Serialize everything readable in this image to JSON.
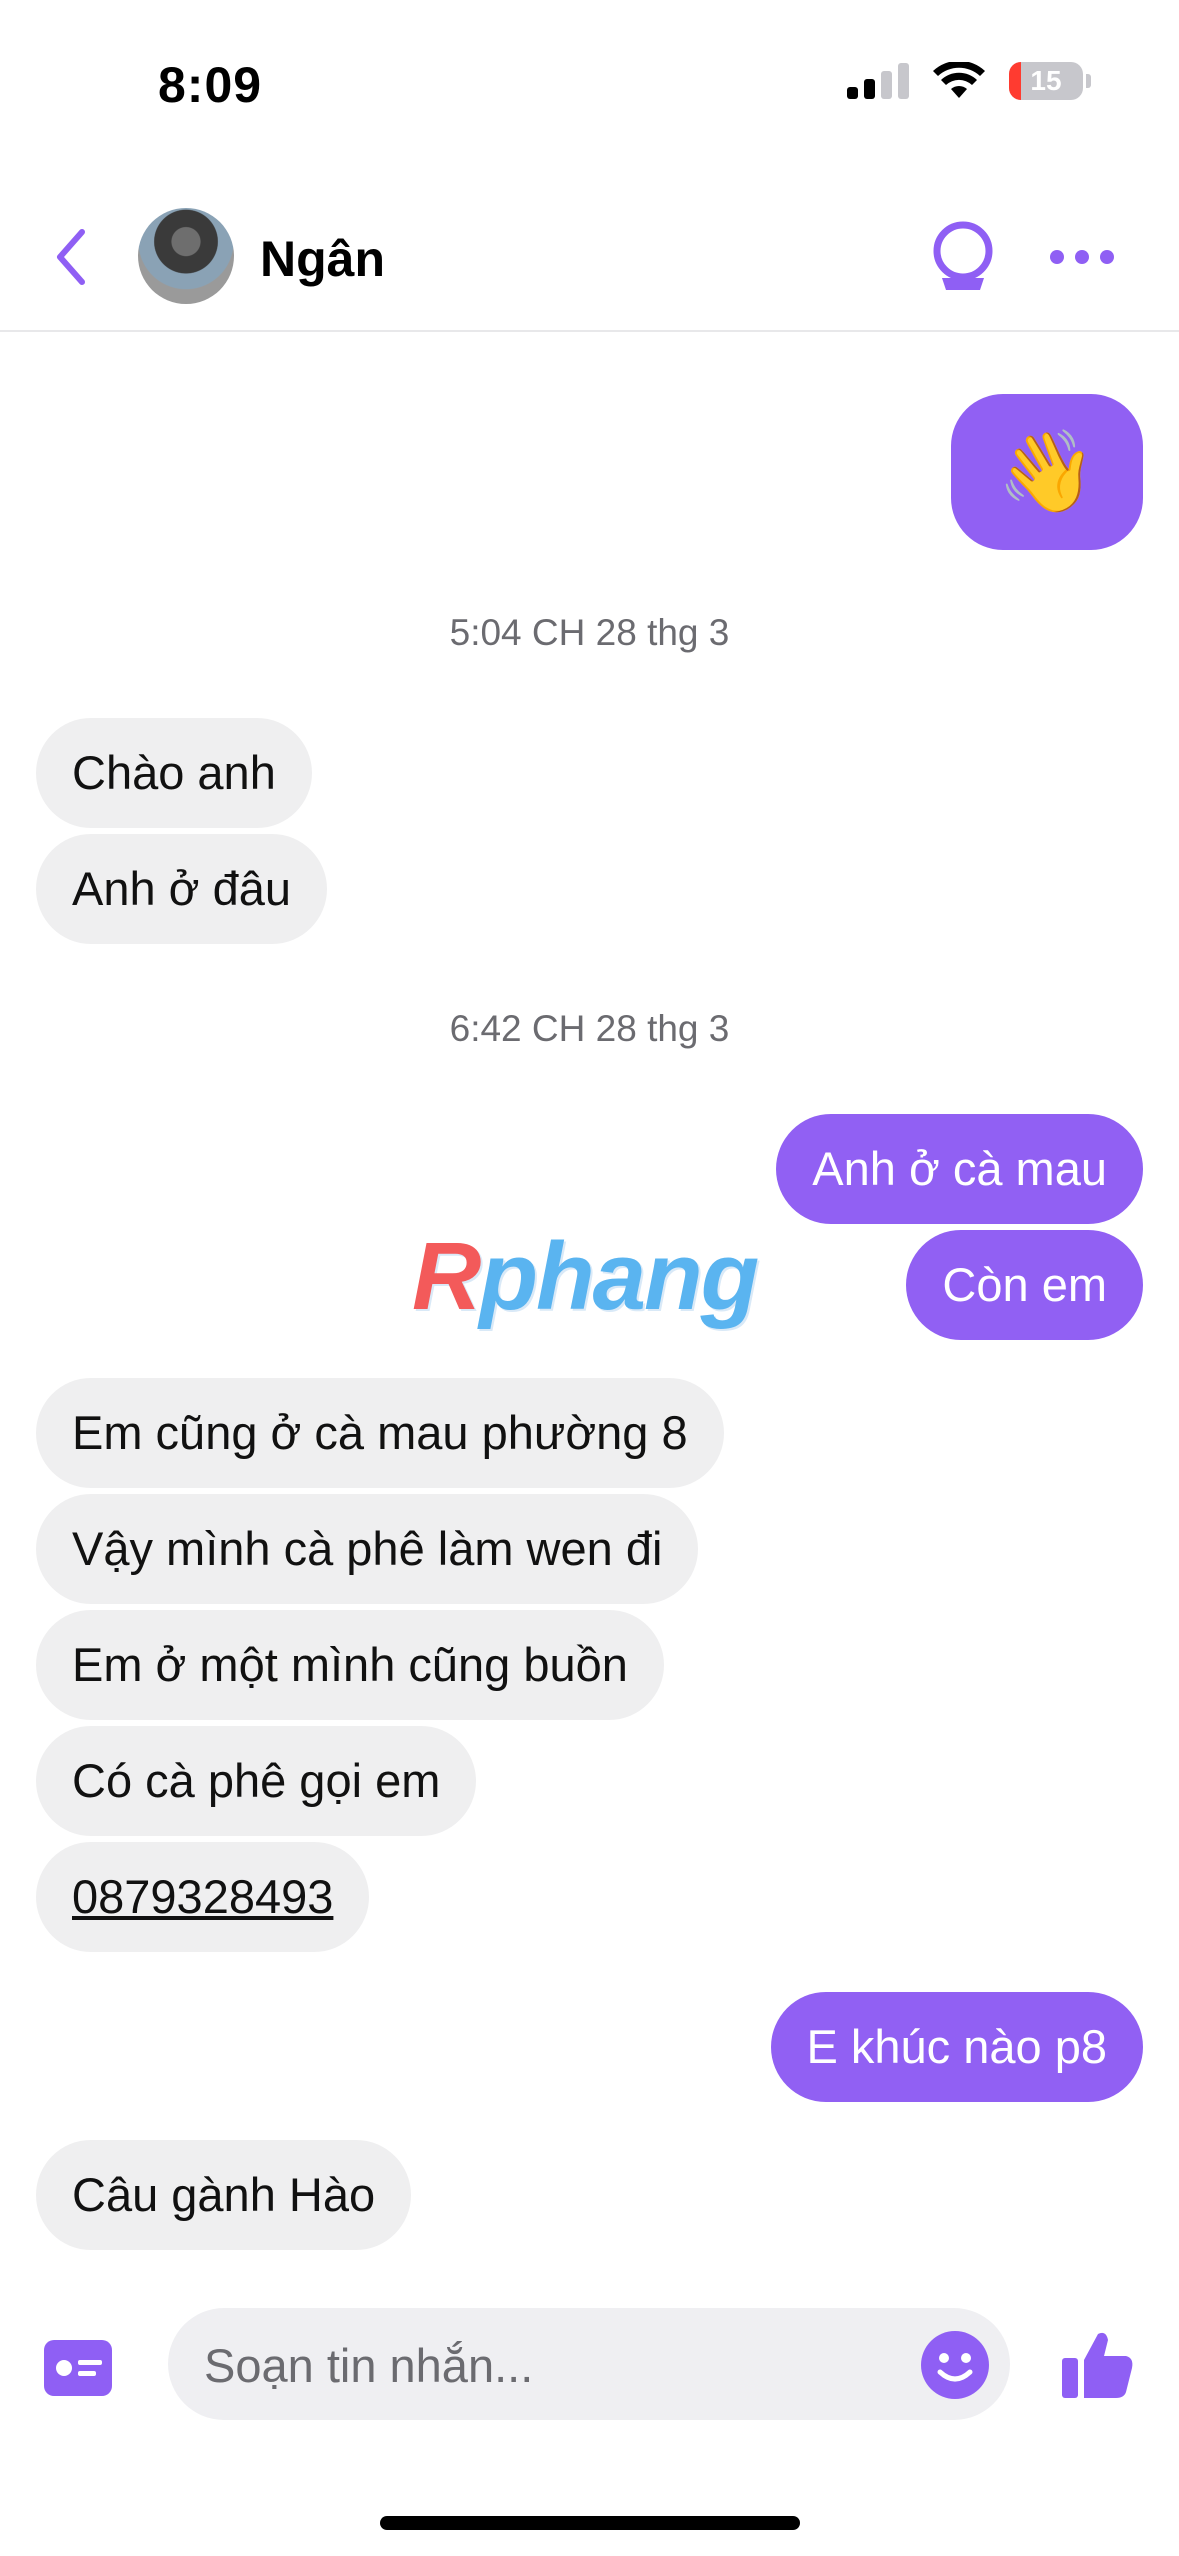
{
  "status_bar": {
    "time": "8:09",
    "battery": "15"
  },
  "header": {
    "contact_name": "Ngân"
  },
  "messages": [
    {
      "side": "out",
      "text": "👋"
    },
    {
      "side": "time",
      "text": "5:04 CH 28 thg 3"
    },
    {
      "side": "in",
      "text": "Chào anh"
    },
    {
      "side": "in",
      "text": "Anh ở đâu"
    },
    {
      "side": "time",
      "text": "6:42 CH 28 thg 3"
    },
    {
      "side": "out",
      "text": "Anh ở cà mau"
    },
    {
      "side": "out",
      "text": "Còn em"
    },
    {
      "side": "in",
      "text": "Em cũng ở cà mau phường 8"
    },
    {
      "side": "in",
      "text": "Vậy mình cà phê làm wen đi"
    },
    {
      "side": "in",
      "text": "Em ở một mình cũng buồn"
    },
    {
      "side": "in",
      "text": "Có cà phê gọi em"
    },
    {
      "side": "in",
      "text": "0879328493"
    },
    {
      "side": "out",
      "text": "E khúc nào p8"
    },
    {
      "side": "in",
      "text": "Câu gành Hào"
    }
  ],
  "watermark": {
    "r": "R",
    "rest": "phang"
  },
  "composer": {
    "placeholder": "Soạn tin nhắn..."
  },
  "colors": {
    "accent": "#9160f3",
    "incoming_bubble": "#efeff0"
  }
}
